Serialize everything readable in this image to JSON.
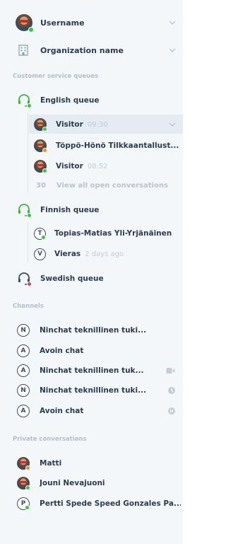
{
  "header": {
    "username": "Username",
    "organization": "Organization name"
  },
  "queues_section": "Customer service queues",
  "queues": [
    {
      "name": "English queue",
      "conversations": [
        {
          "name": "Visitor",
          "time": "09:30"
        },
        {
          "name": "Töppö-Hönö Tilkkaantallust...",
          "time": ""
        },
        {
          "name": "Visitor",
          "time": "08:52"
        }
      ],
      "more_count": "30",
      "more_label": "View all open conversations"
    },
    {
      "name": "Finnish queue",
      "conversations": [
        {
          "initial": "T",
          "name": "Topias-Matias Yli-Yrjänäinen",
          "time": ""
        },
        {
          "initial": "V",
          "name": "Vieras",
          "time": "2 days ago"
        }
      ]
    },
    {
      "name": "Swedish queue"
    }
  ],
  "channels_section": "Channels",
  "channels": [
    {
      "initial": "N",
      "name": "Ninchat teknillinen tuki...",
      "icon": ""
    },
    {
      "initial": "A",
      "name": "Avoin chat",
      "icon": ""
    },
    {
      "initial": "A",
      "name": "Ninchat teknillinen tuk...",
      "icon": "video-icon"
    },
    {
      "initial": "N",
      "name": "Ninchat teknillinen tuki...",
      "icon": "clock-icon"
    },
    {
      "initial": "A",
      "name": "Avoin chat",
      "icon": "pause-icon"
    }
  ],
  "private_section": "Private conversations",
  "private": [
    {
      "name": "Matti"
    },
    {
      "name": "Jouni Nevajuoni"
    },
    {
      "initial": "P",
      "name": "Pertti Spede Speed Gonzales Pa..."
    }
  ],
  "colors": {
    "panel_bg": "#f4f7fa",
    "online": "#3ec43e",
    "away": "#f08a24",
    "busy": "#e84040",
    "text": "#2b3c4e",
    "muted": "#c2cbd4"
  }
}
